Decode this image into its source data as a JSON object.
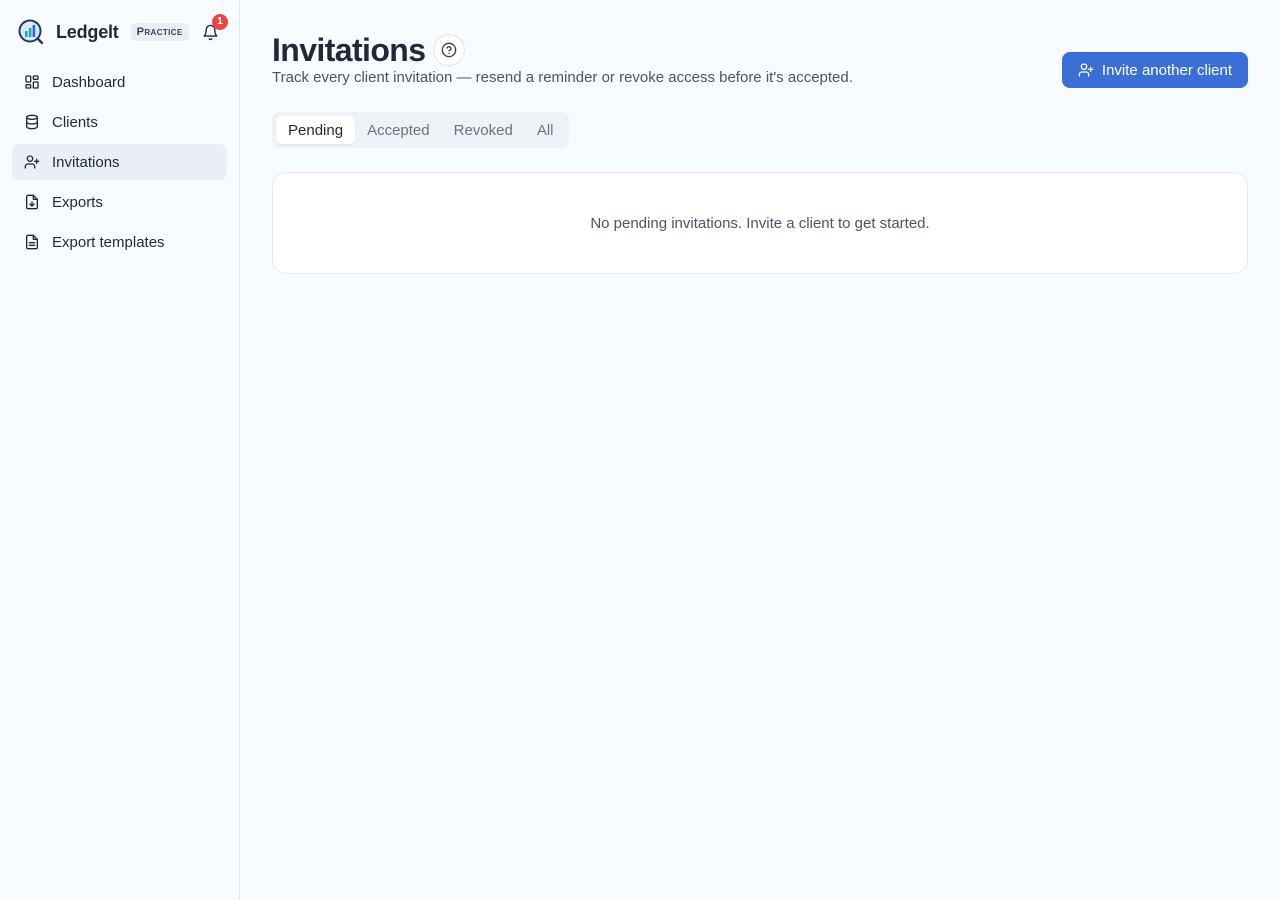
{
  "brand": {
    "name": "Ledgelt",
    "badge": "Practice",
    "notification_count": "1"
  },
  "sidebar": {
    "items": [
      {
        "label": "Dashboard",
        "icon": "dashboard-icon",
        "active": false
      },
      {
        "label": "Clients",
        "icon": "database-icon",
        "active": false
      },
      {
        "label": "Invitations",
        "icon": "user-plus-icon",
        "active": true
      },
      {
        "label": "Exports",
        "icon": "file-download-icon",
        "active": false
      },
      {
        "label": "Export templates",
        "icon": "file-text-icon",
        "active": false
      }
    ]
  },
  "header": {
    "title": "Invitations",
    "subtitle": "Track every client invitation — resend a reminder or revoke access before it's accepted.",
    "invite_label": "Invite another client"
  },
  "tabs": [
    {
      "label": "Pending",
      "active": true
    },
    {
      "label": "Accepted",
      "active": false
    },
    {
      "label": "Revoked",
      "active": false
    },
    {
      "label": "All",
      "active": false
    }
  ],
  "empty_state": {
    "message": "No pending invitations. Invite a client to get started."
  },
  "colors": {
    "accent": "#3b6fd6",
    "badge_red": "#ef4444",
    "active_nav": "#eaeff6"
  }
}
